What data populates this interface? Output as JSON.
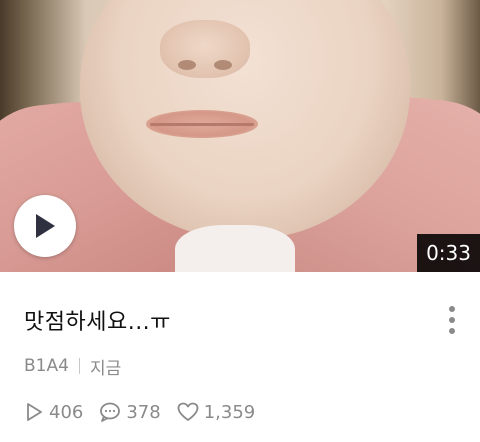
{
  "video": {
    "duration": "0:33",
    "play_icon": "play-icon"
  },
  "post": {
    "title": "맛점하세요...ㅠ",
    "author": "B1A4",
    "time": "지금",
    "more_icon": "more-vertical-icon"
  },
  "stats": {
    "plays": "406",
    "comments": "378",
    "likes": "1,359"
  },
  "colors": {
    "duration_bg": "#000000",
    "meta_text": "#8a8a8a",
    "title_text": "#111111"
  }
}
